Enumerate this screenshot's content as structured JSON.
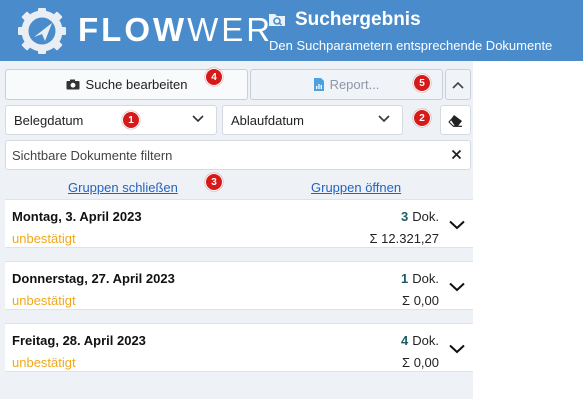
{
  "header": {
    "brand_bold": "FLOW",
    "brand_light": "WER",
    "title": "Suchergebnis",
    "subtitle": "Den Suchparametern entsprechende Dokumente",
    "header_color": "#4a8ccb"
  },
  "toolbar": {
    "edit_search_label": "Suche bearbeiten",
    "report_label": "Report..."
  },
  "sort": {
    "primary": "Belegdatum",
    "secondary": "Ablaufdatum"
  },
  "filter": {
    "placeholder": "Sichtbare Dokumente filtern"
  },
  "links": {
    "close_groups": "Gruppen schließen",
    "open_groups": "Gruppen öffnen"
  },
  "groups": [
    {
      "date": "Montag, 3. April 2023",
      "status": "unbestätigt",
      "count": "3",
      "count_unit": "Dok.",
      "sum": "Σ 12.321,27"
    },
    {
      "date": "Donnerstag, 27. April 2023",
      "status": "unbestätigt",
      "count": "1",
      "count_unit": "Dok.",
      "sum": "Σ 0,00"
    },
    {
      "date": "Freitag, 28. April 2023",
      "status": "unbestätigt",
      "count": "4",
      "count_unit": "Dok.",
      "sum": "Σ 0,00"
    }
  ],
  "badges": [
    "1",
    "2",
    "3",
    "4",
    "5"
  ],
  "icons": [
    "flowwer-logo-icon",
    "folder-search-icon",
    "camera-icon",
    "report-icon",
    "chevron-up-icon",
    "chevron-down-icon",
    "eraser-icon",
    "close-icon"
  ],
  "colors": {
    "status_pending": "#f0a91c",
    "badge": "#d61a1a",
    "link": "#2563c0",
    "count": "#1d5c63"
  }
}
